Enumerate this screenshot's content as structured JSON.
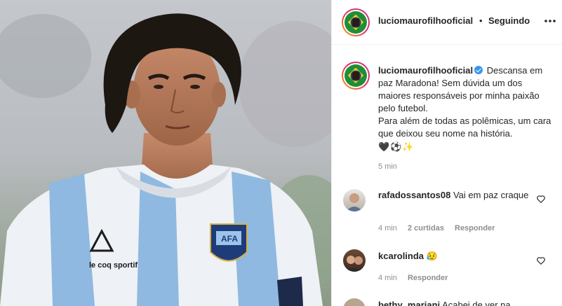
{
  "photo": {
    "shirt_text": "le coq sportif",
    "badge_text": "AFA"
  },
  "header": {
    "username": "luciomaurofilhooficial",
    "separator": "•",
    "follow_label": "Seguindo",
    "more_icon": "more-horizontal-icon"
  },
  "caption": {
    "username": "luciomaurofilhooficial",
    "text_lines": [
      "Descansa em paz Maradona! Sem dúvida um dos maiores responsáveis por minha paixão pelo futebol.",
      "Para além de todas as polêmicas, um cara que deixou seu nome na história."
    ],
    "emojis": [
      "🖤",
      "⚽",
      "✨"
    ],
    "time": "5 min"
  },
  "comments": [
    {
      "username": "rafadossantos08",
      "text": "Vai em paz craque",
      "time": "4 min",
      "likes": "2 curtidas",
      "reply_label": "Responder"
    },
    {
      "username": "kcarolinda",
      "text": "😥",
      "time": "4 min",
      "reply_label": "Responder"
    },
    {
      "username": "bethy_mariani",
      "text": "Acabei de ver na"
    }
  ],
  "colors": {
    "accent": "#3897f0",
    "text": "#262626",
    "muted": "#8e8e8e",
    "border": "#efefef"
  }
}
